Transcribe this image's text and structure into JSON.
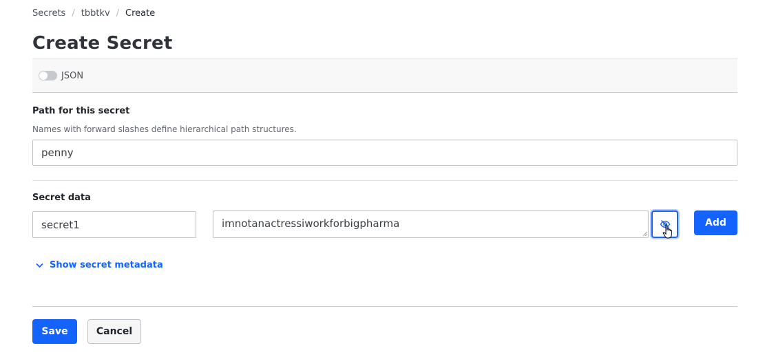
{
  "breadcrumb": {
    "items": [
      "Secrets",
      "tbbtkv",
      "Create"
    ]
  },
  "page": {
    "title": "Create Secret"
  },
  "toolbar": {
    "json_label": "JSON"
  },
  "path": {
    "label": "Path for this secret",
    "help": "Names with forward slashes define hierarchical path structures.",
    "value": "penny"
  },
  "secret_data": {
    "label": "Secret data",
    "key_value": "secret1",
    "secret_value": "imnotanactressiworkforbigpharma",
    "add_label": "Add"
  },
  "metadata": {
    "toggle_label": "Show secret metadata"
  },
  "actions": {
    "save_label": "Save",
    "cancel_label": "Cancel"
  },
  "colors": {
    "primary": "#1563ff",
    "focus": "#1c63f0",
    "border": "#bfc2c7"
  },
  "icons": {
    "masked_toggle": "eye-slash-icon",
    "metadata_expand": "chevron-down-icon",
    "cursor": "hand-pointer-icon"
  }
}
